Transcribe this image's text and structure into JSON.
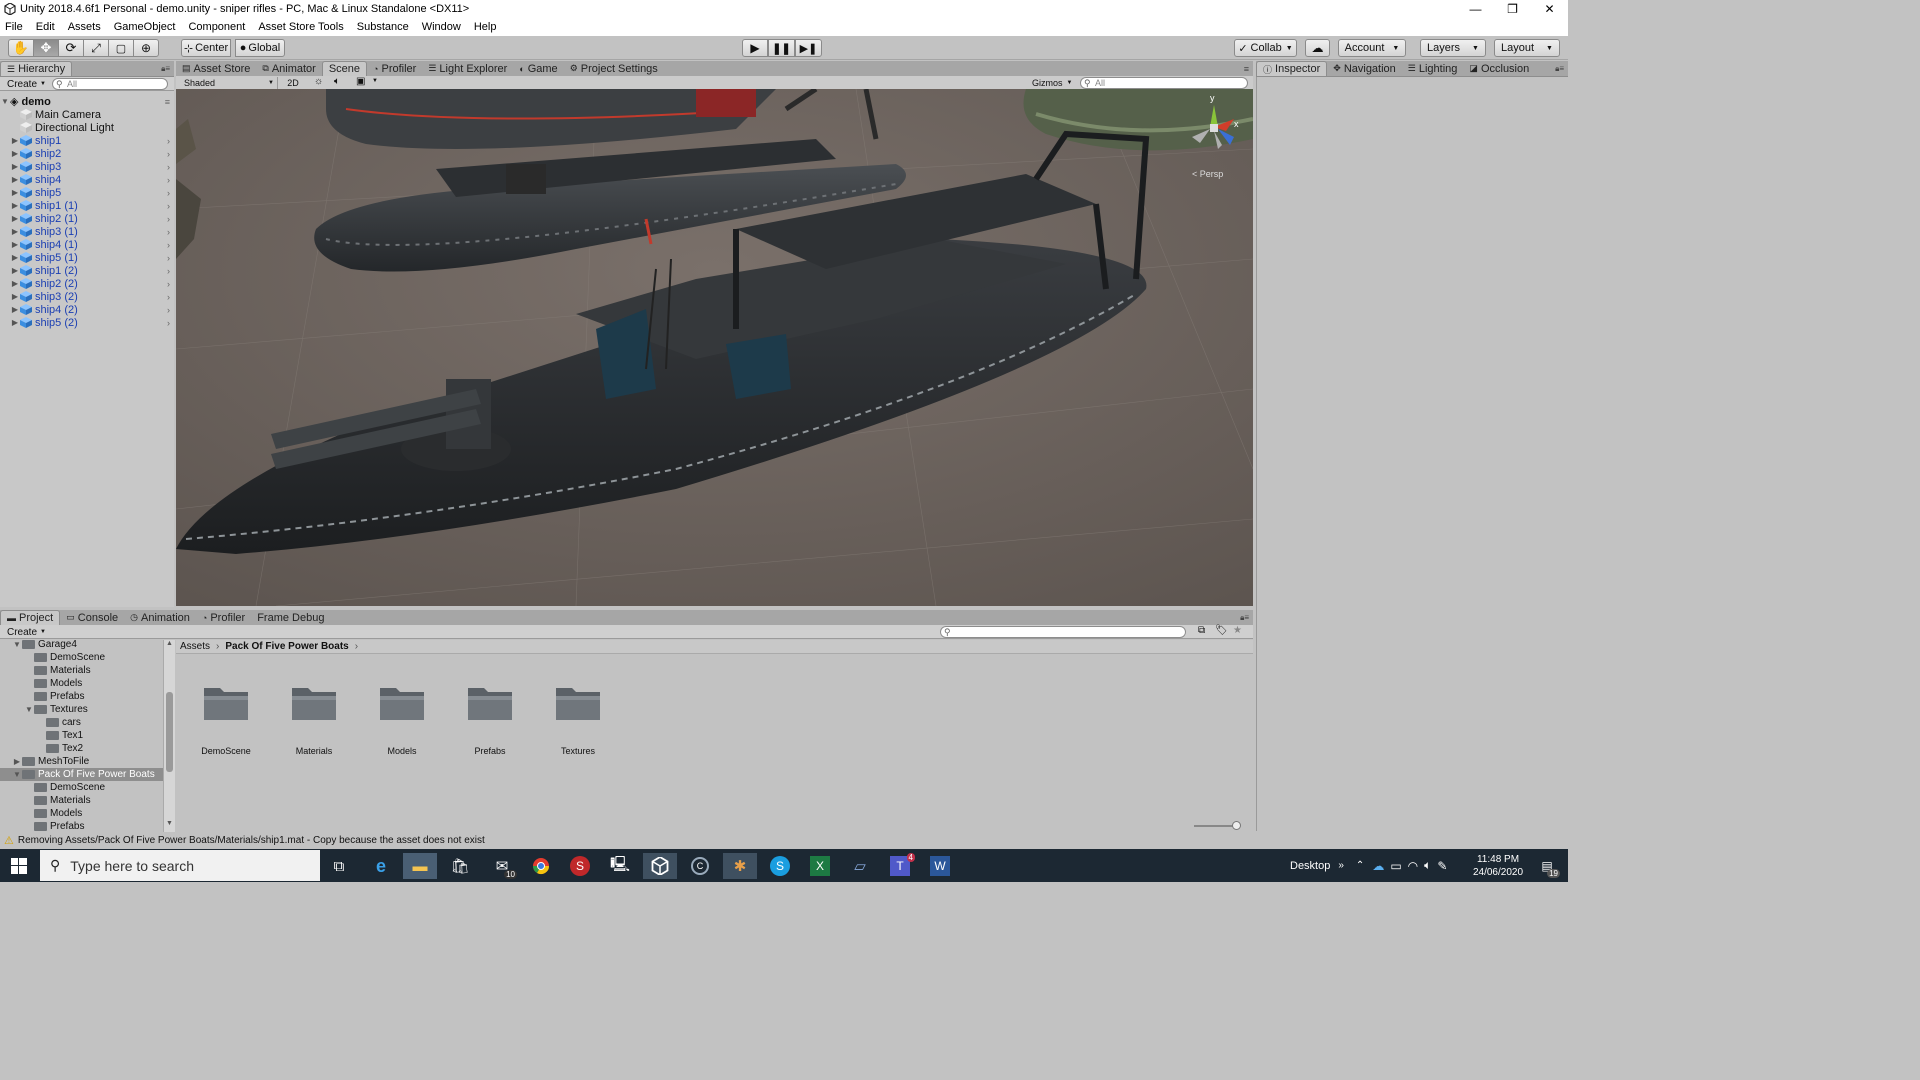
{
  "window": {
    "title": "Unity 2018.4.6f1 Personal - demo.unity - sniper rifles - PC, Mac & Linux Standalone <DX11>",
    "minimize": "—",
    "restore": "❐",
    "close": "✕"
  },
  "menu": [
    "File",
    "Edit",
    "Assets",
    "GameObject",
    "Component",
    "Asset Store Tools",
    "Substance",
    "Window",
    "Help"
  ],
  "toolbar": {
    "tools": [
      "hand-tool",
      "move-tool",
      "rotate-tool",
      "scale-tool",
      "rect-tool",
      "transform-tool"
    ],
    "pivot_label": "Center",
    "space_label": "Global",
    "collab_label": "Collab",
    "account_label": "Account",
    "layers_label": "Layers",
    "layout_label": "Layout"
  },
  "hierarchy": {
    "tab_label": "Hierarchy",
    "create_label": "Create",
    "search_placeholder": "All",
    "scene_name": "demo",
    "items": [
      {
        "label": "Main Camera",
        "expandable": false
      },
      {
        "label": "Directional Light",
        "expandable": false
      },
      {
        "label": "ship1",
        "expandable": true
      },
      {
        "label": "ship2",
        "expandable": true
      },
      {
        "label": "ship3",
        "expandable": true
      },
      {
        "label": "ship4",
        "expandable": true
      },
      {
        "label": "ship5",
        "expandable": true
      },
      {
        "label": "ship1 (1)",
        "expandable": true
      },
      {
        "label": "ship2 (1)",
        "expandable": true
      },
      {
        "label": "ship3 (1)",
        "expandable": true
      },
      {
        "label": "ship4 (1)",
        "expandable": true
      },
      {
        "label": "ship5 (1)",
        "expandable": true
      },
      {
        "label": "ship1 (2)",
        "expandable": true
      },
      {
        "label": "ship2 (2)",
        "expandable": true
      },
      {
        "label": "ship3 (2)",
        "expandable": true
      },
      {
        "label": "ship4 (2)",
        "expandable": true
      },
      {
        "label": "ship5 (2)",
        "expandable": true
      }
    ]
  },
  "scene_tabs": [
    "Asset Store",
    "Animator",
    "Scene",
    "Profiler",
    "Light Explorer",
    "Game",
    "Project Settings"
  ],
  "scene_toolbar": {
    "draw_mode": "Shaded",
    "mode_2d": "2D",
    "gizmos_label": "Gizmos",
    "search_placeholder": "All"
  },
  "scene_gizmo": {
    "axis_y": "y",
    "axis_x": "x",
    "persp": "< Persp"
  },
  "inspector_tabs": [
    "Inspector",
    "Navigation",
    "Lighting",
    "Occlusion"
  ],
  "bottom_tabs": [
    "Project",
    "Console",
    "Animation",
    "Profiler",
    "Frame Debug"
  ],
  "project": {
    "create_label": "Create",
    "tree": [
      {
        "label": "Garage4",
        "depth": 1,
        "arrow": "▼"
      },
      {
        "label": "DemoScene",
        "depth": 2,
        "arrow": ""
      },
      {
        "label": "Materials",
        "depth": 2,
        "arrow": ""
      },
      {
        "label": "Models",
        "depth": 2,
        "arrow": ""
      },
      {
        "label": "Prefabs",
        "depth": 2,
        "arrow": ""
      },
      {
        "label": "Textures",
        "depth": 2,
        "arrow": "▼"
      },
      {
        "label": "cars",
        "depth": 3,
        "arrow": ""
      },
      {
        "label": "Tex1",
        "depth": 3,
        "arrow": ""
      },
      {
        "label": "Tex2",
        "depth": 3,
        "arrow": ""
      },
      {
        "label": "MeshToFile",
        "depth": 1,
        "arrow": "▶"
      },
      {
        "label": "Pack Of Five Power Boats",
        "depth": 1,
        "arrow": "▼",
        "selected": true
      },
      {
        "label": "DemoScene",
        "depth": 2,
        "arrow": ""
      },
      {
        "label": "Materials",
        "depth": 2,
        "arrow": ""
      },
      {
        "label": "Models",
        "depth": 2,
        "arrow": ""
      },
      {
        "label": "Prefabs",
        "depth": 2,
        "arrow": ""
      }
    ],
    "breadcrumb": [
      "Assets",
      "Pack Of Five Power Boats"
    ],
    "folders": [
      "DemoScene",
      "Materials",
      "Models",
      "Prefabs",
      "Textures"
    ]
  },
  "status": {
    "message": "Removing Assets/Pack Of Five Power Boats/Materials/ship1.mat - Copy because the asset does not exist"
  },
  "taskbar": {
    "search_placeholder": "Type here to search",
    "desktop_label": "Desktop",
    "time": "11:48 PM",
    "date": "24/06/2020",
    "mail_badge": "10",
    "teams_badge": "4",
    "notification_badge": "19"
  },
  "colors": {
    "unity_panel": "#c2c2c2",
    "hierarchy_link": "#1b3fb3",
    "taskbar": "#1c2833",
    "scene_ground": "#6b625c"
  }
}
